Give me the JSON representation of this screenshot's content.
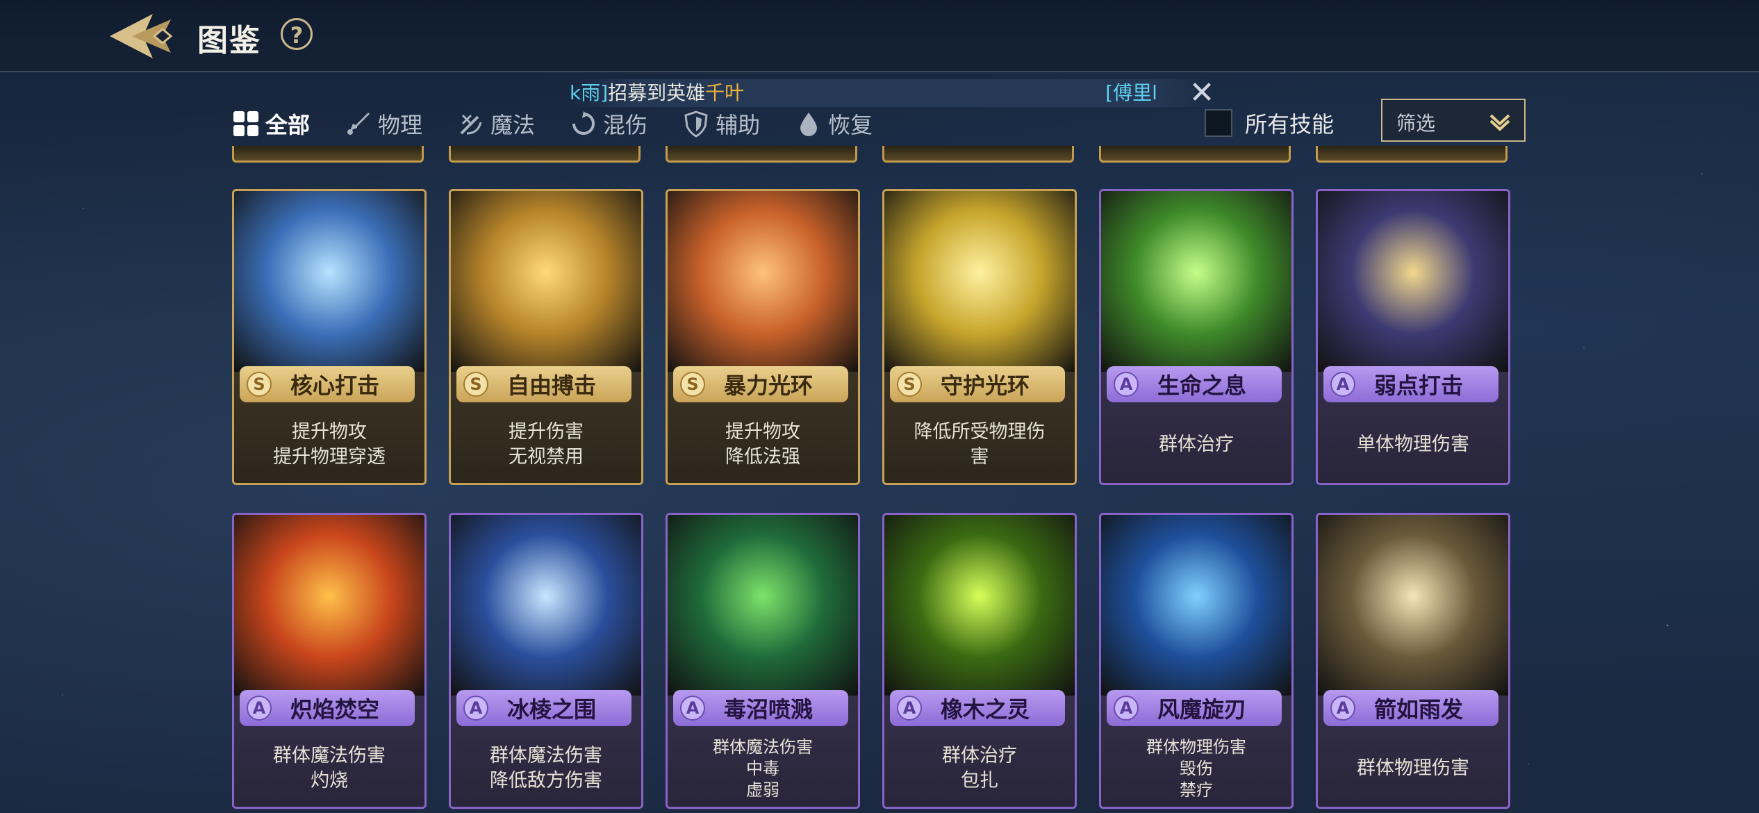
{
  "header": {
    "title": "图鉴",
    "help": "?"
  },
  "ticker": {
    "prefix": "k雨]",
    "middle": "招募到英雄",
    "hero": "千叶",
    "next": "[傅里l",
    "close": "✕"
  },
  "tabs": [
    {
      "label": "全部",
      "active": true,
      "icon": "grid-icon"
    },
    {
      "label": "物理",
      "active": false,
      "icon": "sword-icon"
    },
    {
      "label": "魔法",
      "active": false,
      "icon": "wand-icon"
    },
    {
      "label": "混伤",
      "active": false,
      "icon": "swirl-icon"
    },
    {
      "label": "辅助",
      "active": false,
      "icon": "shield-icon"
    },
    {
      "label": "恢复",
      "active": false,
      "icon": "drop-icon"
    }
  ],
  "all_skills": {
    "label": "所有技能",
    "checked": false
  },
  "filter": {
    "label": "筛选"
  },
  "cards": [
    {
      "grade": "S",
      "rarity": "gold",
      "name": "核心打击",
      "desc": [
        "提升物攻",
        "提升物理穿透"
      ],
      "art": "#3b6fb8",
      "art2": "#b8e3ff"
    },
    {
      "grade": "S",
      "rarity": "gold",
      "name": "自由搏击",
      "desc": [
        "提升伤害",
        "无视禁用"
      ],
      "art": "#b6842a",
      "art2": "#ffd87a"
    },
    {
      "grade": "S",
      "rarity": "gold",
      "name": "暴力光环",
      "desc": [
        "提升物攻",
        "降低法强"
      ],
      "art": "#c8612a",
      "art2": "#ffc27a"
    },
    {
      "grade": "S",
      "rarity": "gold",
      "name": "守护光环",
      "desc": [
        "降低所受物理伤",
        "害"
      ],
      "art": "#c7a52c",
      "art2": "#fff1a0"
    },
    {
      "grade": "A",
      "rarity": "purple",
      "name": "生命之息",
      "desc": [
        "群体治疗"
      ],
      "art": "#3f8a2a",
      "art2": "#c5ff8a"
    },
    {
      "grade": "A",
      "rarity": "purple",
      "name": "弱点打击",
      "desc": [
        "单体物理伤害"
      ],
      "art": "#3d3a72",
      "art2": "#f2d88c"
    },
    {
      "grade": "A",
      "rarity": "purple",
      "name": "炽焰焚空",
      "desc": [
        "群体魔法伤害",
        "灼烧"
      ],
      "art": "#c9461c",
      "art2": "#ffc04a"
    },
    {
      "grade": "A",
      "rarity": "purple",
      "name": "冰棱之围",
      "desc": [
        "群体魔法伤害",
        "降低敌方伤害"
      ],
      "art": "#2b4f9c",
      "art2": "#c8e6ff"
    },
    {
      "grade": "A",
      "rarity": "purple",
      "name": "毒沼喷溅",
      "desc": [
        "群体魔法伤害",
        "中毒",
        "虚弱"
      ],
      "art": "#1f6a3a",
      "art2": "#7de36a"
    },
    {
      "grade": "A",
      "rarity": "purple",
      "name": "橡木之灵",
      "desc": [
        "群体治疗",
        "包扎"
      ],
      "art": "#3a6a12",
      "art2": "#d7ff5a"
    },
    {
      "grade": "A",
      "rarity": "purple",
      "name": "风魔旋刃",
      "desc": [
        "群体物理伤害",
        "毁伤",
        "禁疗"
      ],
      "art": "#1e4f9a",
      "art2": "#7fd0ff"
    },
    {
      "grade": "A",
      "rarity": "purple",
      "name": "箭如雨发",
      "desc": [
        "群体物理伤害"
      ],
      "art": "#6a5a3a",
      "art2": "#f5e6b8"
    }
  ]
}
